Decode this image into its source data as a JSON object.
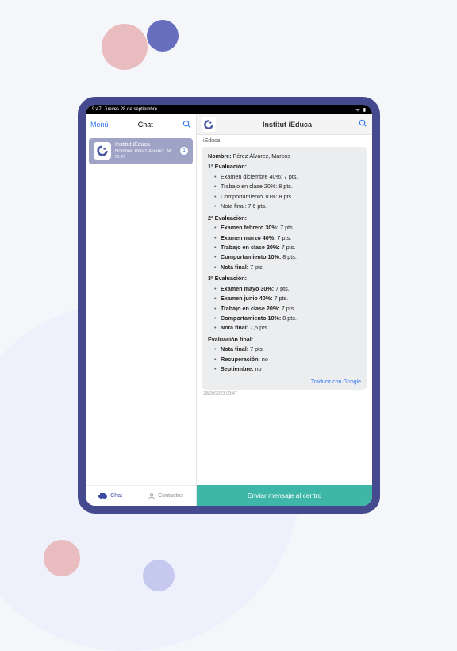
{
  "statusbar": {
    "time": "9:47",
    "date": "Jueves 28 de septiembre"
  },
  "left": {
    "menu": "Menú",
    "title": "Chat",
    "item": {
      "title": "Institut iEduca",
      "subtitle": "Nombre: Pérez Álvarez, Ma...",
      "time": "09:47",
      "badge": "1"
    },
    "tab_chat": "Chat",
    "tab_contacts": "Contactos"
  },
  "right": {
    "title": "Institut iEduca",
    "sender": "iEduca",
    "name_label": "Nombre:",
    "name_value": "Pérez Álvarez, Marcos",
    "evals": [
      {
        "title": "1ª Evaluación:",
        "bold": false,
        "items": [
          {
            "t": "Examen diciembre 40%: 7 pts."
          },
          {
            "t": "Trabajo en clase 20%: 8 pts."
          },
          {
            "t": "Comportamiento 10%: 8 pts."
          },
          {
            "t": "Nota final: 7,6 pts."
          }
        ]
      },
      {
        "title": "2ª Evaluación:",
        "bold": true,
        "items": [
          {
            "l": "Examen febrero 30%:",
            "v": " 7 pts."
          },
          {
            "l": "Examen marzo 40%:",
            "v": " 7 pts."
          },
          {
            "l": "Trabajo en clase 20%:",
            "v": " 7 pts."
          },
          {
            "l": "Comportamiento 10%:",
            "v": " 8 pts."
          },
          {
            "l": "Nota final:",
            "v": " 7 pts."
          }
        ]
      },
      {
        "title": "3ª Evaluación:",
        "bold": true,
        "items": [
          {
            "l": "Examen mayo 30%:",
            "v": " 7 pts."
          },
          {
            "l": "Examen junio 40%:",
            "v": " 7 pts."
          },
          {
            "l": "Trabajo en clase 20%:",
            "v": " 7 pts."
          },
          {
            "l": "Comportamiento 10%:",
            "v": " 8 pts."
          },
          {
            "l": "Nota final:",
            "v": " 7,5 pts."
          }
        ]
      },
      {
        "title": "Evaluación final:",
        "bold": true,
        "items": [
          {
            "l": "Nota final:",
            "v": " 7 pts."
          },
          {
            "l": "Recuperación:",
            "v": " no"
          },
          {
            "l": "Septiembre:",
            "v": " no"
          }
        ]
      }
    ],
    "translate": "Traducir con Google",
    "timestamp": "28/09/2023 09:47",
    "send": "Enviar mensaje al centro"
  }
}
